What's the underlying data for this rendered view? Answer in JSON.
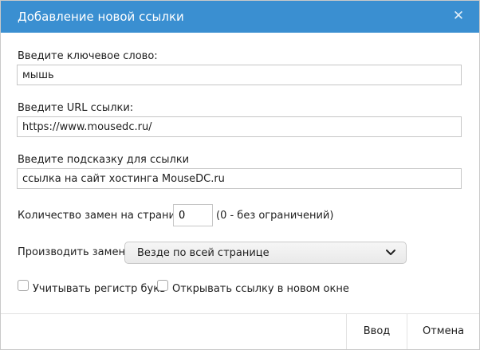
{
  "dialog": {
    "title": "Добавление новой ссылки",
    "close_icon": "close-icon"
  },
  "form": {
    "keyword": {
      "label": "Введите ключевое слово:",
      "value": "мышь"
    },
    "url": {
      "label": "Введите URL ссылки:",
      "value": "https://www.mousedc.ru/"
    },
    "hint": {
      "label": "Введите подсказку для ссылки",
      "value": "ссылка на сайт хостинга MouseDC.ru"
    },
    "replace_count": {
      "label": "Количество замен на страницу:",
      "value": "0",
      "note": "(0 - без ограничений)"
    },
    "replace_mode": {
      "label": "Производить замену:",
      "selected": "Везде по всей странице",
      "icon": "chevron-down-icon"
    },
    "case_sensitive": {
      "label": "Учитывать регистр букв",
      "checked": false
    },
    "new_window": {
      "label": "Открывать ссылку в новом окне",
      "checked": false
    }
  },
  "footer": {
    "ok_label": "Ввод",
    "cancel_label": "Отмена"
  },
  "colors": {
    "titlebar": "#3a8fd1",
    "title_text": "#ffffff",
    "border": "#c6c6c6"
  }
}
